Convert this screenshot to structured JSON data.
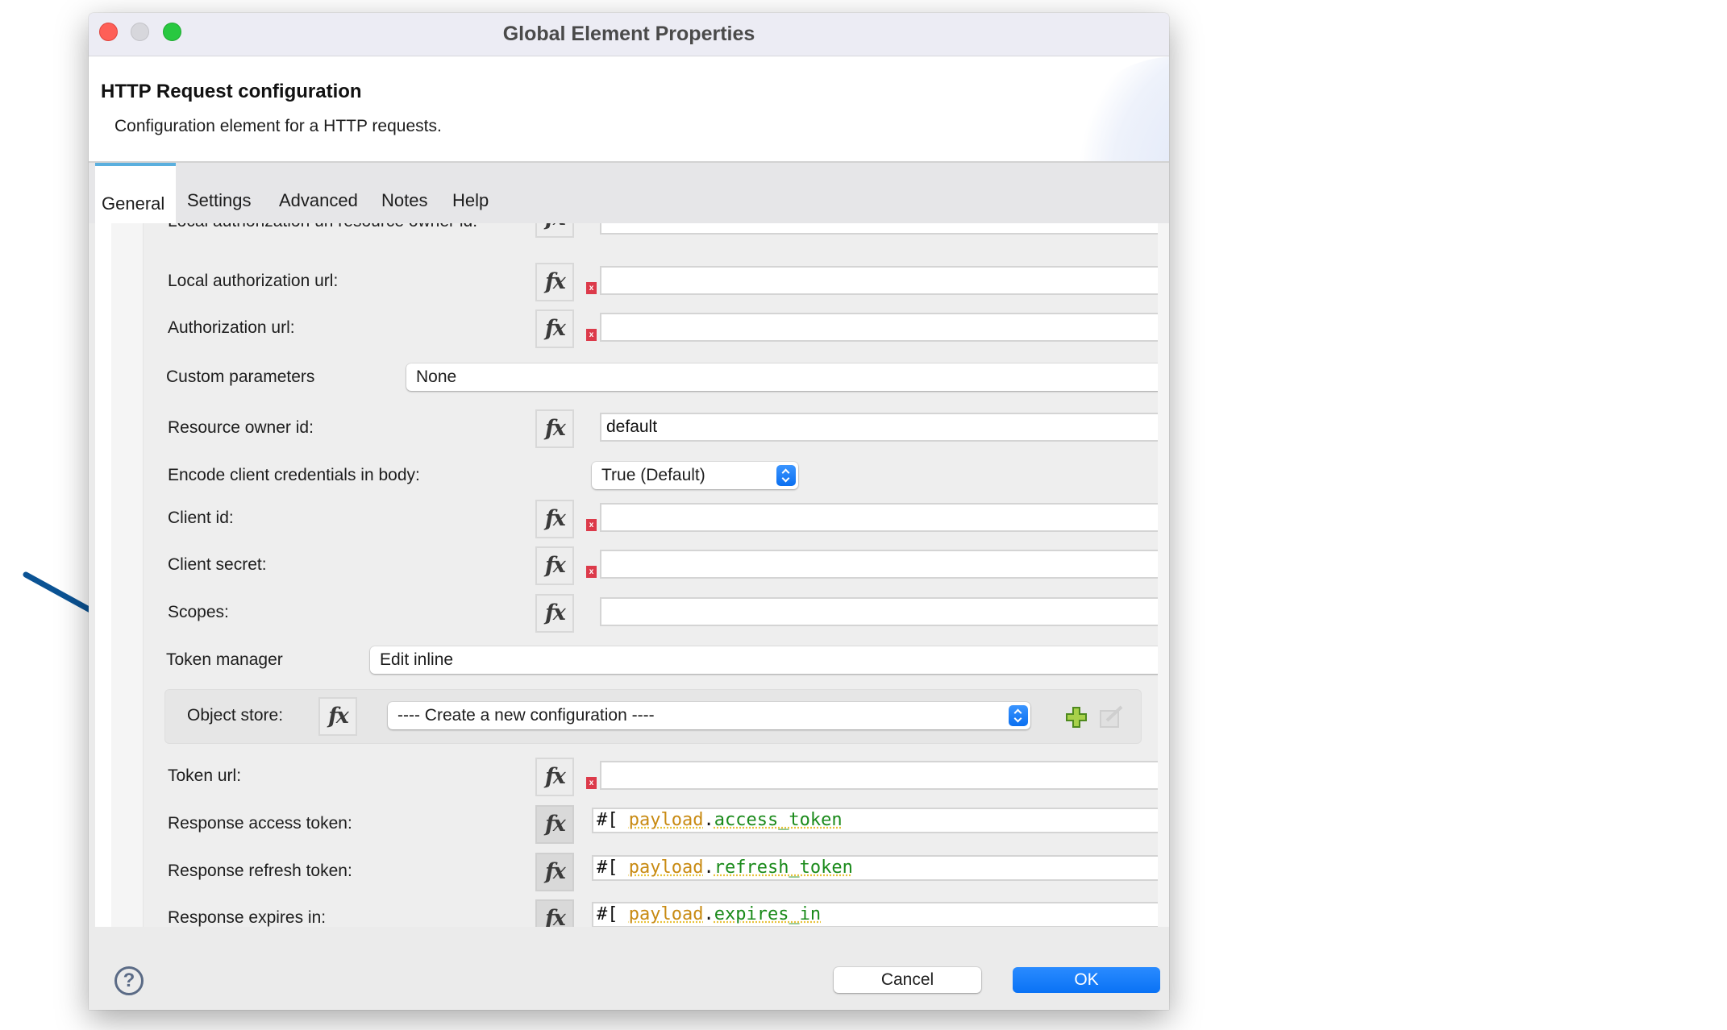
{
  "window": {
    "title": "Global Element Properties"
  },
  "header": {
    "title": "HTTP Request configuration",
    "description": "Configuration element for a HTTP requests."
  },
  "tabs": [
    {
      "label": "General",
      "active": true
    },
    {
      "label": "Settings",
      "active": false
    },
    {
      "label": "Advanced",
      "active": false
    },
    {
      "label": "Notes",
      "active": false
    },
    {
      "label": "Help",
      "active": false
    }
  ],
  "form": {
    "cutoff_label": "Local authorization url resource owner id:",
    "local_authorization_url": {
      "label": "Local authorization url:",
      "value": "",
      "required": true
    },
    "authorization_url": {
      "label": "Authorization url:",
      "value": "",
      "required": true
    },
    "custom_parameters": {
      "label": "Custom parameters",
      "value": "None"
    },
    "resource_owner_id": {
      "label": "Resource owner id:",
      "value": "default"
    },
    "encode_client_credentials": {
      "label": "Encode client credentials in body:",
      "value": "True (Default)"
    },
    "client_id": {
      "label": "Client id:",
      "value": "",
      "required": true
    },
    "client_secret": {
      "label": "Client secret:",
      "value": "",
      "required": true
    },
    "scopes": {
      "label": "Scopes:",
      "value": ""
    },
    "token_manager": {
      "label": "Token manager",
      "value": "Edit inline"
    },
    "object_store": {
      "label": "Object store:",
      "value": "---- Create a new configuration ----"
    },
    "token_url": {
      "label": "Token url:",
      "value": "",
      "required": true
    },
    "response_access_token": {
      "label": "Response access token:",
      "prefix": "#[",
      "keyword": "payload",
      "dot": ".",
      "property": "access_token",
      "suffix": "]"
    },
    "response_refresh_token": {
      "label": "Response refresh token:",
      "prefix": "#[",
      "keyword": "payload",
      "dot": ".",
      "property": "refresh_token",
      "suffix": "]"
    },
    "response_expires_in": {
      "label": "Response expires in:",
      "prefix": "#[",
      "keyword": "payload",
      "dot": ".",
      "property": "expires_in",
      "suffix": "]"
    }
  },
  "icons": {
    "fx": "fx",
    "error_marker": "x",
    "help": "?"
  },
  "footer": {
    "cancel_label": "Cancel",
    "ok_label": "OK"
  },
  "colors": {
    "accent": "#0a72f5",
    "error": "#dc3a4a",
    "annotation_arrow": "#0b5394",
    "expr_keyword": "#c88a12",
    "expr_property": "#1a8a1a"
  }
}
